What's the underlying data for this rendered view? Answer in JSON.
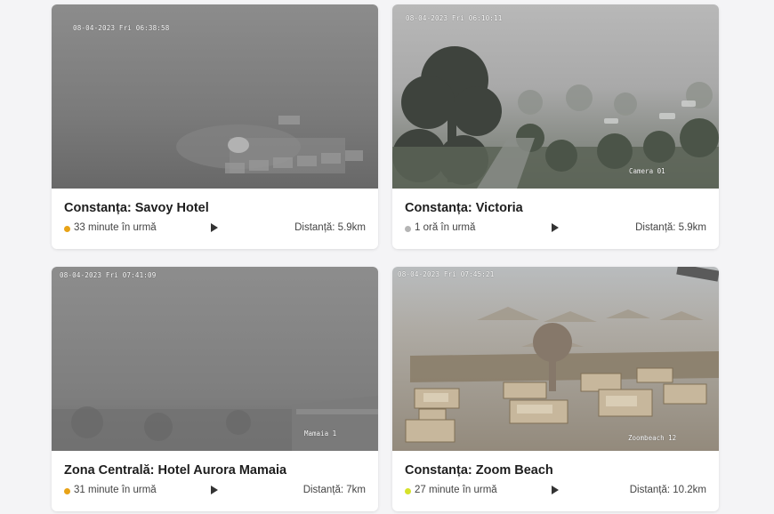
{
  "cards": [
    {
      "title": "Constanța: Savoy Hotel",
      "age": "33 minute în urmă",
      "distance": "Distanță: 5.9km",
      "timestamp": "08-04-2023 Fri 06:38:58",
      "camera_label": "",
      "status_color": "#e8a317"
    },
    {
      "title": "Constanța: Victoria",
      "age": "1 oră în urmă",
      "distance": "Distanță: 5.9km",
      "timestamp": "08-04-2023 Fri 06:10:11",
      "camera_label": "Camera 01",
      "status_color": "#b5b5b5"
    },
    {
      "title": "Zona Centrală: Hotel Aurora Mamaia",
      "age": "31 minute în urmă",
      "distance": "Distanță: 7km",
      "timestamp": "08-04-2023 Fri 07:41:09",
      "camera_label": "Mamaia 1",
      "status_color": "#e8a317"
    },
    {
      "title": "Constanța: Zoom Beach",
      "age": "27 minute în urmă",
      "distance": "Distanță: 10.2km",
      "timestamp": "08-04-2023 Fri 07:45:21",
      "camera_label": "Zoombeach 12",
      "status_color": "#d6e22a"
    }
  ]
}
